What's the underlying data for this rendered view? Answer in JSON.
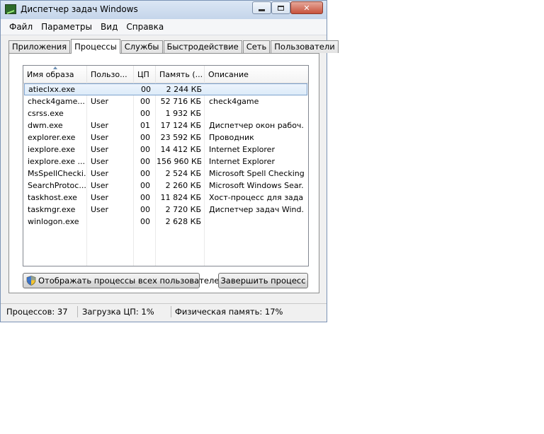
{
  "window": {
    "title": "Диспетчер задач Windows"
  },
  "menu": [
    "Файл",
    "Параметры",
    "Вид",
    "Справка"
  ],
  "tabs": [
    {
      "label": "Приложения",
      "active": false
    },
    {
      "label": "Процессы",
      "active": true
    },
    {
      "label": "Службы",
      "active": false
    },
    {
      "label": "Быстродействие",
      "active": false
    },
    {
      "label": "Сеть",
      "active": false
    },
    {
      "label": "Пользователи",
      "active": false
    }
  ],
  "columns": {
    "name": "Имя образа",
    "user": "Пользо...",
    "cpu": "ЦП",
    "memory": "Память (...",
    "description": "Описание"
  },
  "processes": [
    {
      "name": "atieclxx.exe",
      "user": "",
      "cpu": "00",
      "memory": "2 244 КБ",
      "description": "",
      "selected": true
    },
    {
      "name": "check4game....",
      "user": "User",
      "cpu": "00",
      "memory": "52 716 КБ",
      "description": "check4game"
    },
    {
      "name": "csrss.exe",
      "user": "",
      "cpu": "00",
      "memory": "1 932 КБ",
      "description": ""
    },
    {
      "name": "dwm.exe",
      "user": "User",
      "cpu": "01",
      "memory": "17 124 КБ",
      "description": "Диспетчер окон рабоч..."
    },
    {
      "name": "explorer.exe",
      "user": "User",
      "cpu": "00",
      "memory": "23 592 КБ",
      "description": "Проводник"
    },
    {
      "name": "iexplore.exe",
      "user": "User",
      "cpu": "00",
      "memory": "14 412 КБ",
      "description": "Internet Explorer"
    },
    {
      "name": "iexplore.exe ...",
      "user": "User",
      "cpu": "00",
      "memory": "156 960 КБ",
      "description": "Internet Explorer"
    },
    {
      "name": "MsSpellChecki...",
      "user": "User",
      "cpu": "00",
      "memory": "2 524 КБ",
      "description": "Microsoft Spell Checking..."
    },
    {
      "name": "SearchProtoc...",
      "user": "User",
      "cpu": "00",
      "memory": "2 260 КБ",
      "description": "Microsoft Windows Sear..."
    },
    {
      "name": "taskhost.exe",
      "user": "User",
      "cpu": "00",
      "memory": "11 824 КБ",
      "description": "Хост-процесс для зада..."
    },
    {
      "name": "taskmgr.exe",
      "user": "User",
      "cpu": "00",
      "memory": "2 720 КБ",
      "description": "Диспетчер задач Wind..."
    },
    {
      "name": "winlogon.exe",
      "user": "",
      "cpu": "00",
      "memory": "2 628 КБ",
      "description": ""
    }
  ],
  "buttons": {
    "show_all": "Отображать процессы всех пользователей",
    "end_process": "Завершить процесс"
  },
  "status": {
    "processes": "Процессов: 37",
    "cpu": "Загрузка ЦП: 1%",
    "memory": "Физическая память: 17%"
  }
}
